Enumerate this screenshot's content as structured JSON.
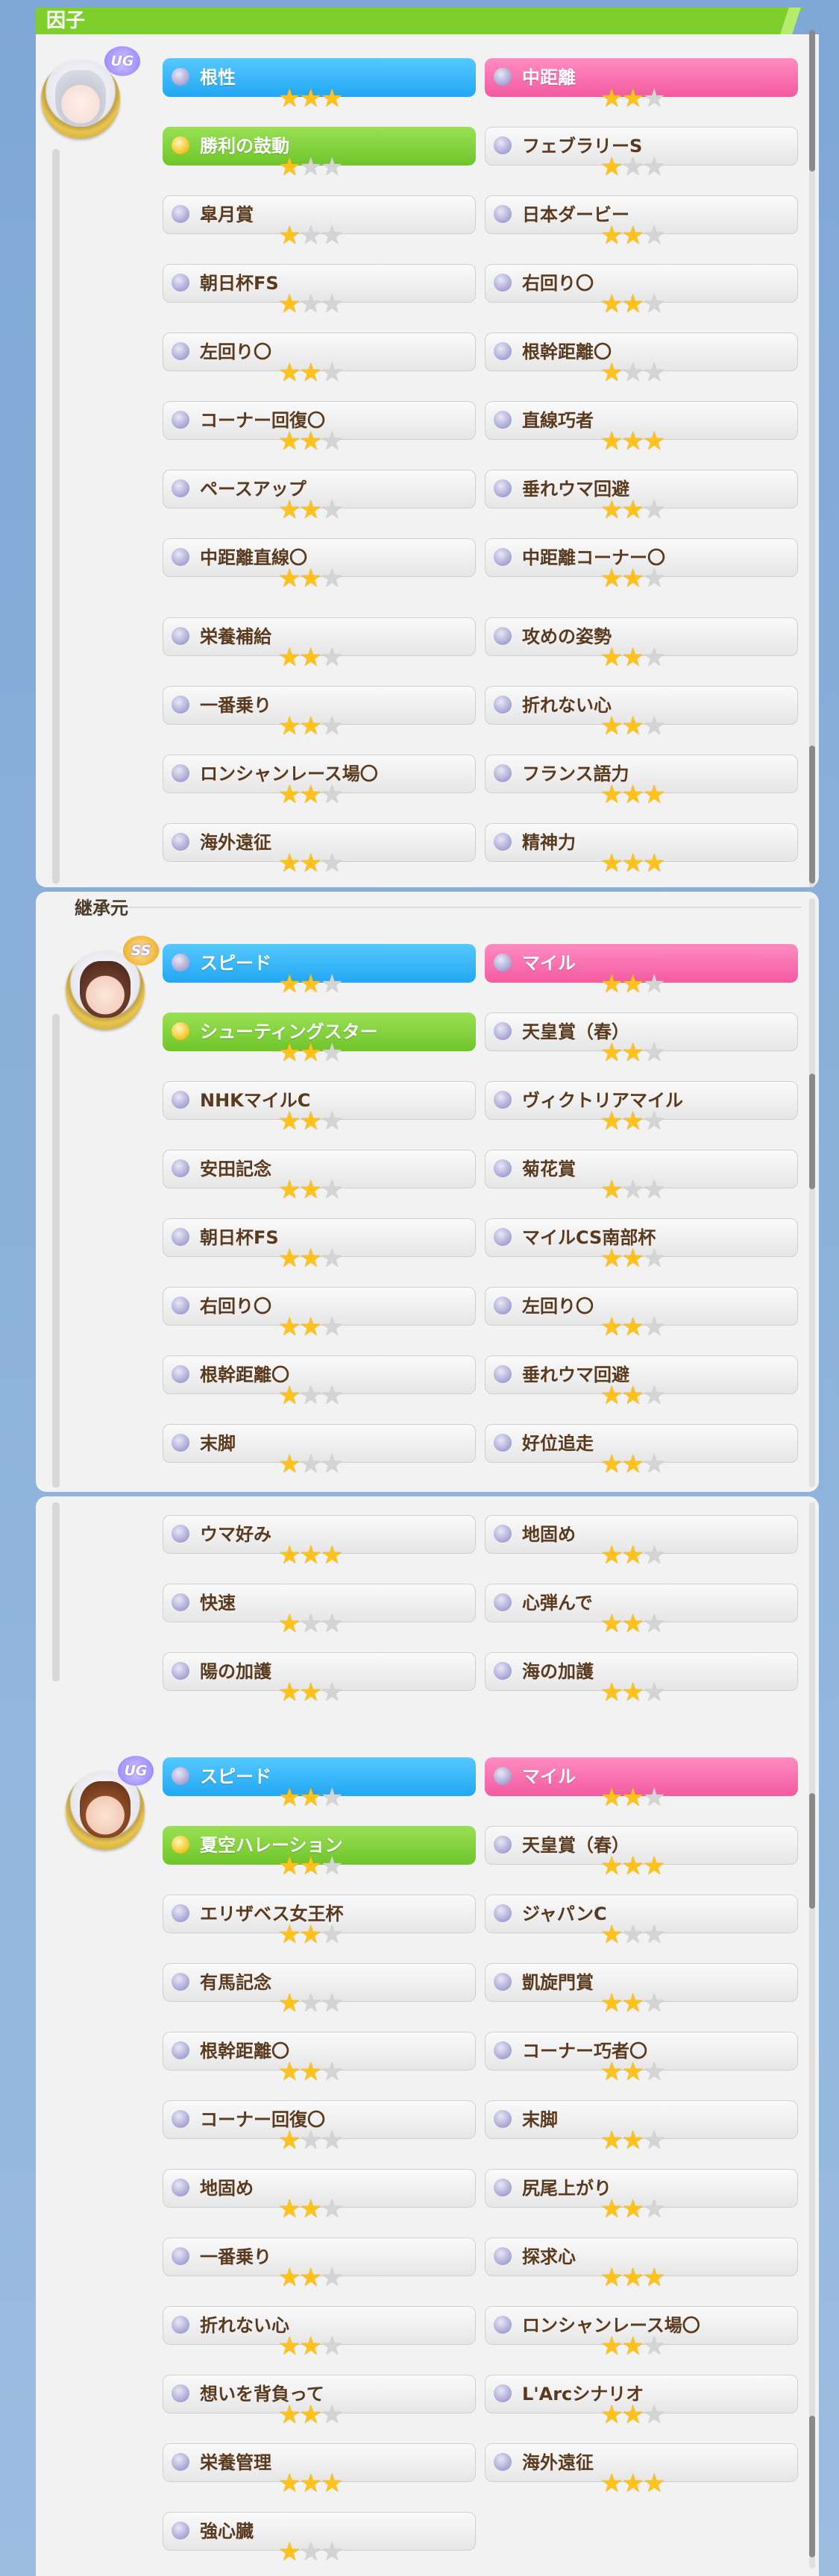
{
  "header": {
    "title": "因子"
  },
  "inherit_label": "継承元",
  "groups": [
    {
      "rank": "UG",
      "factors": [
        {
          "label": "根性",
          "stars": 3,
          "color": "blue"
        },
        {
          "label": "中距離",
          "stars": 2,
          "color": "pink"
        },
        {
          "label": "勝利の鼓動",
          "stars": 1,
          "color": "green"
        },
        {
          "label": "フェブラリーS",
          "stars": 1,
          "color": "white"
        },
        {
          "label": "皐月賞",
          "stars": 1,
          "color": "white"
        },
        {
          "label": "日本ダービー",
          "stars": 2,
          "color": "white"
        },
        {
          "label": "朝日杯FS",
          "stars": 1,
          "color": "white"
        },
        {
          "label": "右回り〇",
          "stars": 2,
          "color": "white"
        },
        {
          "label": "左回り〇",
          "stars": 2,
          "color": "white"
        },
        {
          "label": "根幹距離〇",
          "stars": 1,
          "color": "white"
        },
        {
          "label": "コーナー回復〇",
          "stars": 2,
          "color": "white"
        },
        {
          "label": "直線巧者",
          "stars": 3,
          "color": "white"
        },
        {
          "label": "ペースアップ",
          "stars": 2,
          "color": "white"
        },
        {
          "label": "垂れウマ回避",
          "stars": 2,
          "color": "white"
        },
        {
          "label": "中距離直線〇",
          "stars": 2,
          "color": "white"
        },
        {
          "label": "中距離コーナー〇",
          "stars": 2,
          "color": "white"
        },
        {
          "label": "栄養補給",
          "stars": 2,
          "color": "white"
        },
        {
          "label": "攻めの姿勢",
          "stars": 2,
          "color": "white"
        },
        {
          "label": "一番乗り",
          "stars": 2,
          "color": "white"
        },
        {
          "label": "折れない心",
          "stars": 2,
          "color": "white"
        },
        {
          "label": "ロンシャンレース場〇",
          "stars": 2,
          "color": "white"
        },
        {
          "label": "フランス語力",
          "stars": 3,
          "color": "white"
        },
        {
          "label": "海外遠征",
          "stars": 2,
          "color": "white"
        },
        {
          "label": "精神力",
          "stars": 3,
          "color": "white"
        }
      ]
    },
    {
      "rank": "SS",
      "factors": [
        {
          "label": "スピード",
          "stars": 2,
          "color": "blue"
        },
        {
          "label": "マイル",
          "stars": 2,
          "color": "pink"
        },
        {
          "label": "シューティングスター",
          "stars": 2,
          "color": "green"
        },
        {
          "label": "天皇賞（春）",
          "stars": 2,
          "color": "white"
        },
        {
          "label": "NHKマイルC",
          "stars": 2,
          "color": "white"
        },
        {
          "label": "ヴィクトリアマイル",
          "stars": 2,
          "color": "white"
        },
        {
          "label": "安田記念",
          "stars": 2,
          "color": "white"
        },
        {
          "label": "菊花賞",
          "stars": 1,
          "color": "white"
        },
        {
          "label": "朝日杯FS",
          "stars": 2,
          "color": "white"
        },
        {
          "label": "マイルCS南部杯",
          "stars": 2,
          "color": "white"
        },
        {
          "label": "右回り〇",
          "stars": 2,
          "color": "white"
        },
        {
          "label": "左回り〇",
          "stars": 2,
          "color": "white"
        },
        {
          "label": "根幹距離〇",
          "stars": 1,
          "color": "white"
        },
        {
          "label": "垂れウマ回避",
          "stars": 2,
          "color": "white"
        },
        {
          "label": "末脚",
          "stars": 1,
          "color": "white"
        },
        {
          "label": "好位追走",
          "stars": 2,
          "color": "white"
        },
        {
          "label": "ウマ好み",
          "stars": 3,
          "color": "white"
        },
        {
          "label": "地固め",
          "stars": 2,
          "color": "white"
        },
        {
          "label": "快速",
          "stars": 1,
          "color": "white"
        },
        {
          "label": "心弾んで",
          "stars": 2,
          "color": "white"
        },
        {
          "label": "陽の加護",
          "stars": 2,
          "color": "white"
        },
        {
          "label": "海の加護",
          "stars": 2,
          "color": "white"
        }
      ]
    },
    {
      "rank": "UG",
      "factors": [
        {
          "label": "スピード",
          "stars": 2,
          "color": "blue"
        },
        {
          "label": "マイル",
          "stars": 2,
          "color": "pink"
        },
        {
          "label": "夏空ハレーション",
          "stars": 2,
          "color": "green"
        },
        {
          "label": "天皇賞（春）",
          "stars": 3,
          "color": "white"
        },
        {
          "label": "エリザベス女王杯",
          "stars": 2,
          "color": "white"
        },
        {
          "label": "ジャパンC",
          "stars": 1,
          "color": "white"
        },
        {
          "label": "有馬記念",
          "stars": 1,
          "color": "white"
        },
        {
          "label": "凱旋門賞",
          "stars": 2,
          "color": "white"
        },
        {
          "label": "根幹距離〇",
          "stars": 2,
          "color": "white"
        },
        {
          "label": "コーナー巧者〇",
          "stars": 2,
          "color": "white"
        },
        {
          "label": "コーナー回復〇",
          "stars": 1,
          "color": "white"
        },
        {
          "label": "末脚",
          "stars": 2,
          "color": "white"
        },
        {
          "label": "地固め",
          "stars": 2,
          "color": "white"
        },
        {
          "label": "尻尾上がり",
          "stars": 2,
          "color": "white"
        },
        {
          "label": "一番乗り",
          "stars": 2,
          "color": "white"
        },
        {
          "label": "探求心",
          "stars": 3,
          "color": "white"
        },
        {
          "label": "折れない心",
          "stars": 2,
          "color": "white"
        },
        {
          "label": "ロンシャンレース場〇",
          "stars": 2,
          "color": "white"
        },
        {
          "label": "想いを背負って",
          "stars": 2,
          "color": "white"
        },
        {
          "label": "L'Arcシナリオ",
          "stars": 2,
          "color": "white"
        },
        {
          "label": "栄養管理",
          "stars": 3,
          "color": "white"
        },
        {
          "label": "海外遠征",
          "stars": 3,
          "color": "white"
        },
        {
          "label": "強心臓",
          "stars": 1,
          "color": "white"
        }
      ]
    }
  ],
  "colors": {
    "blue": "#22a7f2",
    "pink": "#f35aa0",
    "green": "#6fc52a",
    "star_on": "#ffc21a",
    "star_off": "#d4d4d4"
  },
  "icons": {
    "rank_badge": "rank-badge-icon",
    "factor_dot": "factor-dot-icon",
    "star": "star-icon"
  }
}
